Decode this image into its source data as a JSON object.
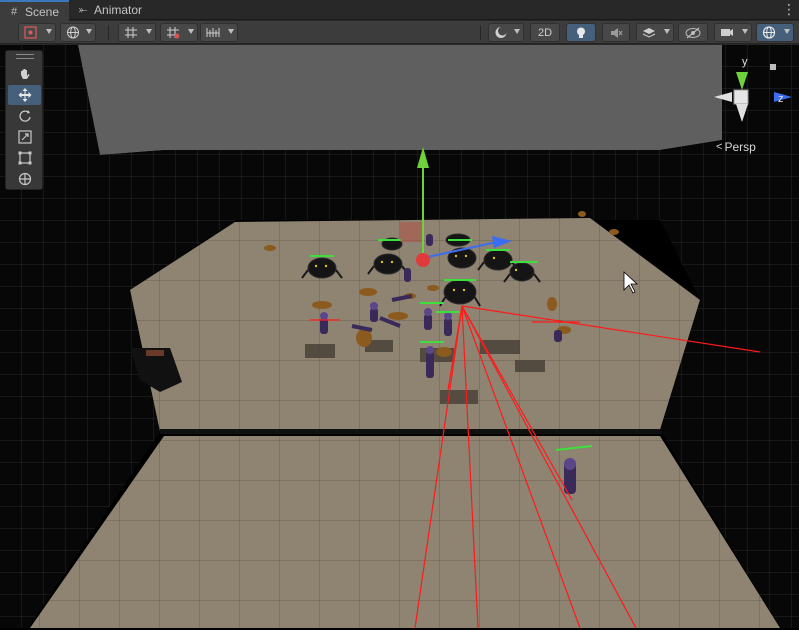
{
  "tabs": [
    {
      "label": "Scene",
      "icon": "scene-grid-icon",
      "active": true
    },
    {
      "label": "Animator",
      "icon": "animator-icon",
      "active": false
    }
  ],
  "toolbar": {
    "mode_2d_label": "2D",
    "items": [
      "draw-mode",
      "global-space",
      "grid-snapping",
      "increment-snap",
      "shading-mode",
      "2d",
      "lighting",
      "audio",
      "effects",
      "hidden-objects",
      "camera",
      "gizmos"
    ]
  },
  "tools": [
    "hand",
    "move",
    "rotate",
    "scale",
    "rect",
    "transform"
  ],
  "gizmo": {
    "y_label": "y",
    "z_label": "z",
    "projection_label": "Persp"
  },
  "colors": {
    "axis_x": "#e03a3a",
    "axis_y": "#6ed23c",
    "axis_z": "#3c6cf0",
    "selection_blue": "#46607c",
    "floor": "#8c8070"
  }
}
